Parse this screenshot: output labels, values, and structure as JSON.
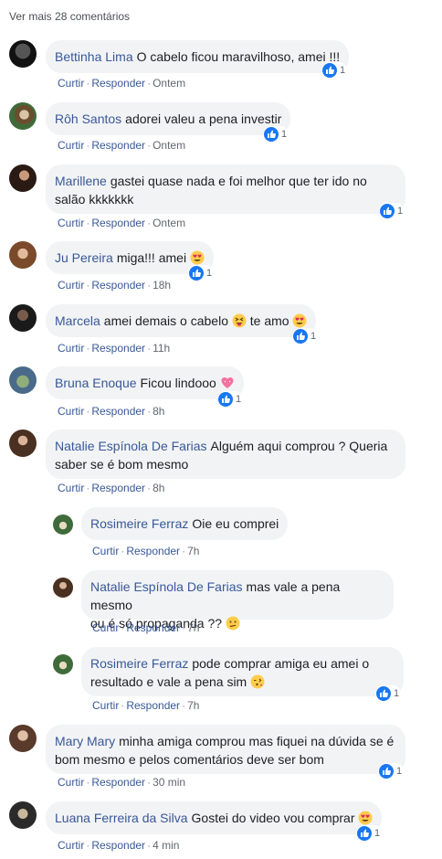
{
  "more_comments": "Ver mais 28 comentários",
  "actions": {
    "like": "Curtir",
    "reply": "Responder"
  },
  "comments": [
    {
      "name": "Bettinha Lima",
      "text": "O cabelo ficou maravilhoso, amei !!!",
      "time": "Ontem",
      "likes": "1"
    },
    {
      "name": "Rôh Santos",
      "text": "adorei valeu a pena investir",
      "time": "Ontem",
      "likes": "1"
    },
    {
      "name": "Marillene",
      "text1": "gastei quase nada e foi melhor que ter ido no",
      "text2": "salão kkkkkkk",
      "time": "Ontem",
      "likes": "1"
    },
    {
      "name": "Ju Pereira",
      "text": "miga!!! amei",
      "time": "18h",
      "likes": "1"
    },
    {
      "name": "Marcela",
      "text": "amei demais o cabelo",
      "text_b": "te amo",
      "time": "11h",
      "likes": "1"
    },
    {
      "name": "Bruna Enoque",
      "text": "Ficou lindooo",
      "time": "8h",
      "likes": "1"
    },
    {
      "name": "Natalie Espínola De Farias",
      "text1": "Alguém aqui comprou ? Queria",
      "text2": "saber se é bom mesmo",
      "time": "8h"
    },
    {
      "name": "Rosimeire Ferraz",
      "text": "Oie eu comprei",
      "time": "7h"
    },
    {
      "name": "Natalie Espínola De Farias",
      "text1": "mas vale a pena mesmo",
      "text2": "ou é só propaganda ??",
      "time": "7h"
    },
    {
      "name": "Rosimeire Ferraz",
      "text1": "pode comprar amiga eu amei o",
      "text2": "resultado e vale a pena sim",
      "time": "7h",
      "likes": "1"
    },
    {
      "name": "Mary Mary",
      "text1": "minha amiga comprou mas fiquei na dúvida se é",
      "text2": "bom mesmo e pelos comentários deve ser bom",
      "time": "30 min",
      "likes": "1"
    },
    {
      "name": "Luana Ferreira da Silva",
      "text": "Gostei do video vou comprar",
      "time": "4 min",
      "likes": "1"
    }
  ],
  "colors": {
    "link": "#385898",
    "bubble": "#f2f3f5",
    "like_blue": "#1877f2",
    "meta": "#606770"
  }
}
